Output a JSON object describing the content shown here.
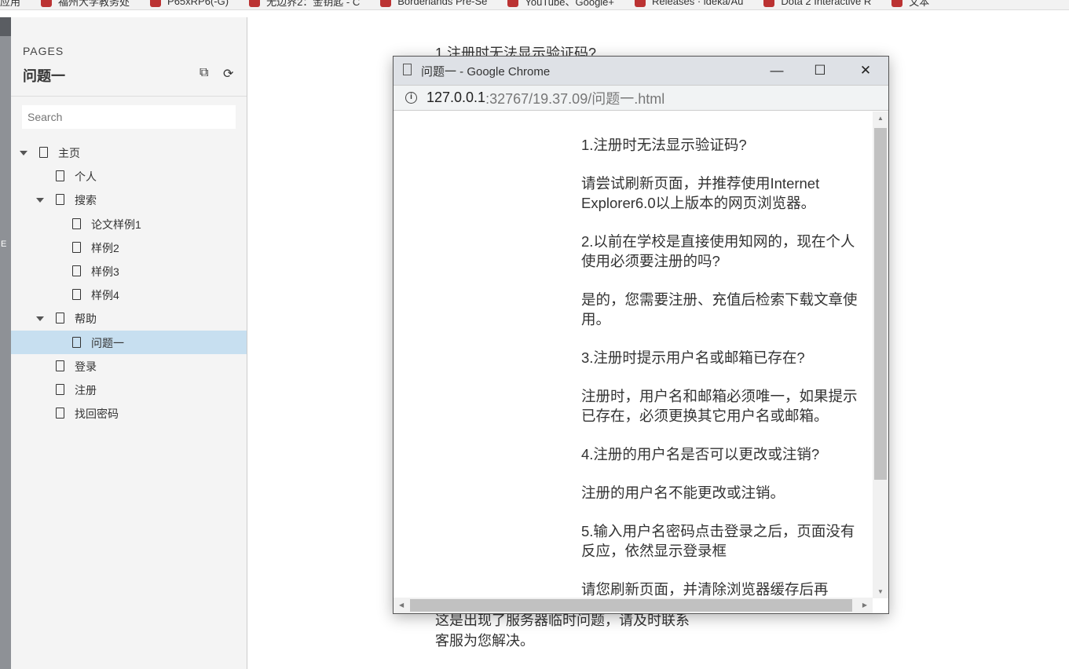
{
  "bookmarks": [
    "应用",
    "福州大学教务处",
    "P65xRP6(-G)",
    "无边界2：金钥匙 - C",
    "Borderlands Pre-Se",
    "YouTube、Google+",
    "Releases · ideka/Au",
    "Dota 2 Interactive R",
    "文本"
  ],
  "strip_letter": "E",
  "sidebar": {
    "section": "PAGES",
    "title": "问题一",
    "search_placeholder": "Search",
    "tree": [
      {
        "label": "主页",
        "level": 0,
        "expanded": true
      },
      {
        "label": "个人",
        "level": 1
      },
      {
        "label": "搜索",
        "level": 1,
        "expanded": true
      },
      {
        "label": "论文样例1",
        "level": 2
      },
      {
        "label": "样例2",
        "level": 2
      },
      {
        "label": "样例3",
        "level": 2
      },
      {
        "label": "样例4",
        "level": 2
      },
      {
        "label": "帮助",
        "level": 1,
        "expanded": true
      },
      {
        "label": "问题一",
        "level": 2,
        "selected": true
      },
      {
        "label": "登录",
        "level": 1
      },
      {
        "label": "注册",
        "level": 1
      },
      {
        "label": "找回密码",
        "level": 1
      }
    ]
  },
  "main": {
    "top_text": "1.注册时无法显示验证码?",
    "bottom_lines": [
      "这是出现了服务器临时问题，请及时联系",
      "客服为您解决。"
    ]
  },
  "popup": {
    "title": "问题一 - Google Chrome",
    "url_host": "127.0.0.1",
    "url_path": ":32767/19.37.09/问题一.html",
    "paragraphs": [
      "1.注册时无法显示验证码?",
      "请尝试刷新页面，并推荐使用Internet Explorer6.0以上版本的网页浏览器。",
      "2.以前在学校是直接使用知网的，现在个人使用必须要注册的吗?",
      "是的，您需要注册、充值后检索下载文章使用。",
      "3.注册时提示用户名或邮箱已存在?",
      "注册时，用户名和邮箱必须唯一，如果提示已存在，必须更换其它用户名或邮箱。",
      "4.注册的用户名是否可以更改或注销?",
      "注册的用户名不能更改或注销。",
      "5.输入用户名密码点击登录之后，页面没有反应，依然显示登录框",
      "请您刷新页面，并清除浏览器缓存后再"
    ]
  }
}
